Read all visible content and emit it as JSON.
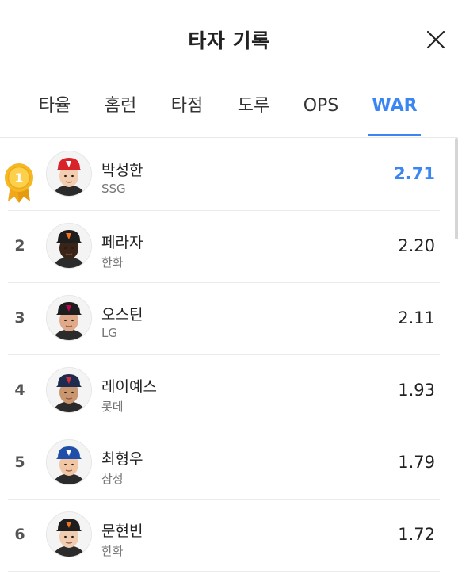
{
  "header": {
    "title": "타자 기록"
  },
  "tabs": [
    {
      "label": "타율"
    },
    {
      "label": "홈런"
    },
    {
      "label": "타점"
    },
    {
      "label": "도루"
    },
    {
      "label": "OPS"
    },
    {
      "label": "WAR",
      "active": true
    }
  ],
  "players": [
    {
      "rank": "1",
      "name": "박성한",
      "team": "SSG",
      "value": "2.71",
      "cap_color": "#d8232a",
      "cap_logo_color": "#ffffff",
      "skin": "#f2cdb0",
      "highlight": true
    },
    {
      "rank": "2",
      "name": "페라자",
      "team": "한화",
      "value": "2.20",
      "cap_color": "#1e1e1e",
      "cap_logo_color": "#f37321",
      "skin": "#3a2418"
    },
    {
      "rank": "3",
      "name": "오스틴",
      "team": "LG",
      "value": "2.11",
      "cap_color": "#1e1e1e",
      "cap_logo_color": "#c30452",
      "skin": "#e0a98a"
    },
    {
      "rank": "4",
      "name": "레이예스",
      "team": "롯데",
      "value": "1.93",
      "cap_color": "#1d2b4f",
      "cap_logo_color": "#d22d38",
      "skin": "#c8966f"
    },
    {
      "rank": "5",
      "name": "최형우",
      "team": "삼성",
      "value": "1.79",
      "cap_color": "#1f4fa8",
      "cap_logo_color": "#ffffff",
      "skin": "#f0c6a4"
    },
    {
      "rank": "6",
      "name": "문현빈",
      "team": "한화",
      "value": "1.72",
      "cap_color": "#1e1e1e",
      "cap_logo_color": "#f37321",
      "skin": "#f0cdb0"
    }
  ],
  "medal": {
    "label": "1",
    "color": "#f4b520"
  }
}
